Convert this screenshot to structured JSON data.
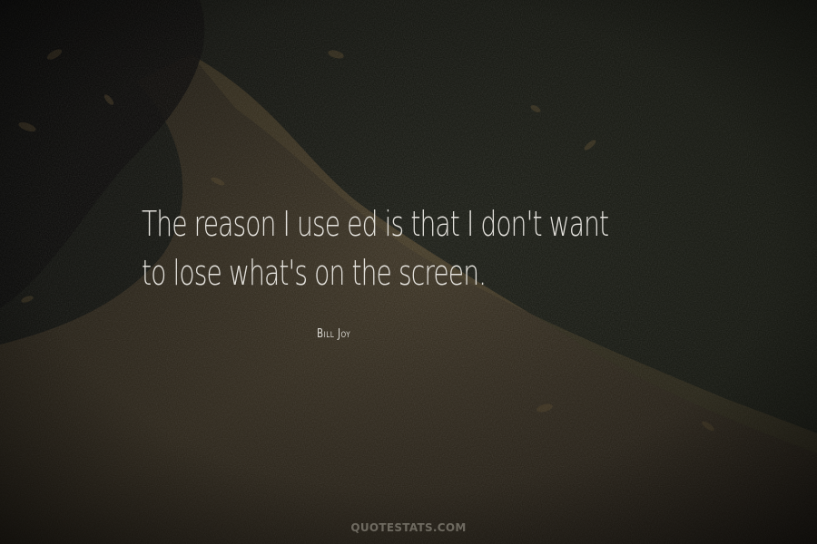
{
  "quote": {
    "lines": [
      "The reason I use ed is that I don't want",
      "to lose what's on the screen."
    ]
  },
  "author": "Bill Joy",
  "watermark": "QUOTESTATS.COM",
  "colors": {
    "background": "#0e0d0b",
    "text": "#e4e2dd",
    "watermark": "#7b776d"
  }
}
